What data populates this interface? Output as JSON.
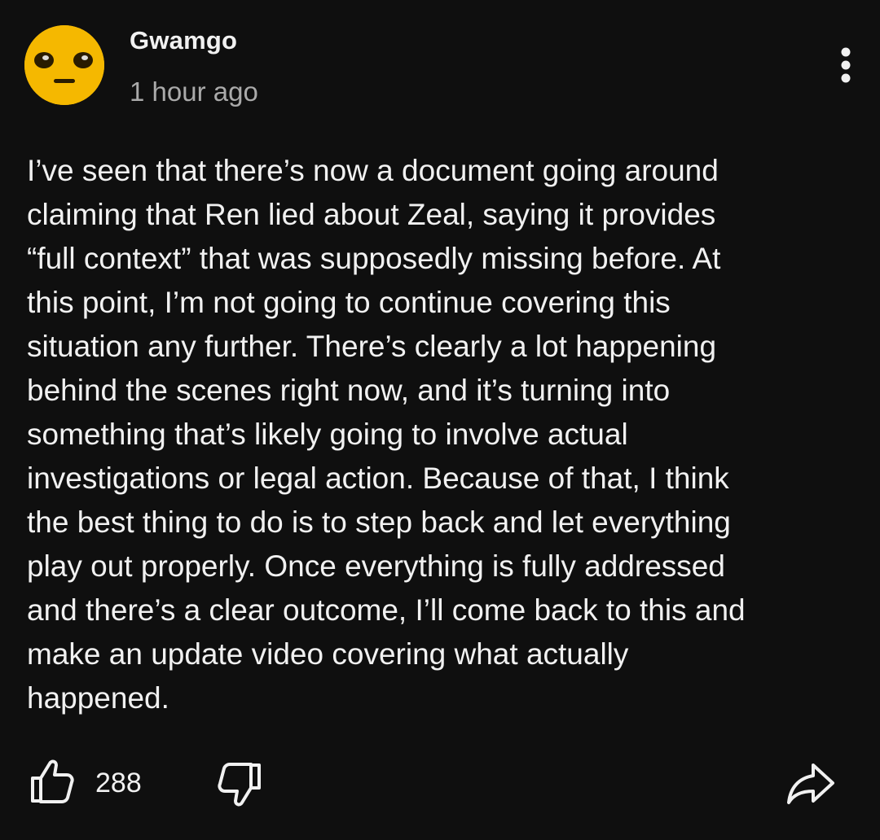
{
  "comment": {
    "author": "Gwamgo",
    "timestamp": "1 hour ago",
    "avatar_color": "#f5b800",
    "avatar_icon": "unamused-face",
    "text": "I’ve seen that there’s now a document going around\nclaiming that Ren lied about Zeal, saying it provides\n“full context” that was supposedly missing before. At\nthis point, I’m not going to continue covering this\nsituation any further. There’s clearly a lot happening\nbehind the scenes right now, and it’s turning into\nsomething that’s likely going to involve actual\ninvestigations or legal action. Because of that, I think\nthe best thing to do is to step back and let everything\nplay out properly. Once everything is fully addressed\nand there’s a clear outcome, I’ll come back to this and\nmake an update video covering what actually\nhappened.",
    "like_count": "288",
    "icons": {
      "more": "more-vertical-icon",
      "like": "thumbs-up-icon",
      "dislike": "thumbs-down-icon",
      "share": "share-icon"
    }
  }
}
